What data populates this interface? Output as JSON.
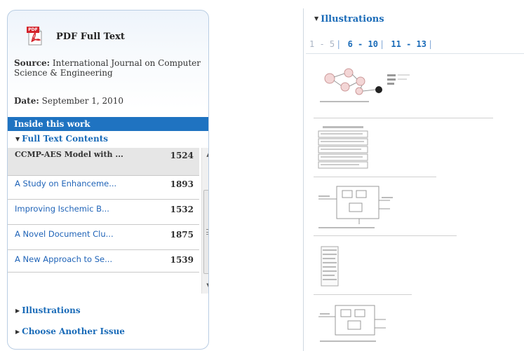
{
  "pdf": {
    "label": "PDF Full Text",
    "icon": "pdf-file-icon",
    "icon_tag": "PDF"
  },
  "source": {
    "label": "Source:",
    "value": "International Journal on Computer Science & Engineering"
  },
  "date": {
    "label": "Date:",
    "value": "September 1,  2010"
  },
  "inside": {
    "label": "Inside this work"
  },
  "full_text": {
    "label": "Full Text Contents"
  },
  "toc": [
    {
      "title": "CCMP-AES Model with ...",
      "number": "1524",
      "active": true
    },
    {
      "title": "A Study on Enhanceme...",
      "number": "1893"
    },
    {
      "title": "Improving Ischemic B...",
      "number": "1532"
    },
    {
      "title": "A Novel Document Clu...",
      "number": "1875"
    },
    {
      "title": "A New Approach to Se...",
      "number": "1539"
    }
  ],
  "left_sections": {
    "illustrations": "Illustrations",
    "choose_issue": "Choose Another Issue"
  },
  "illustrations": {
    "title": "Illustrations",
    "pages": {
      "current": "1 - 5",
      "p2": "6 - 10",
      "p3": "11 - 13"
    },
    "thumbnails": 5
  },
  "colors": {
    "accent": "#1f73c1",
    "link": "#1a6bb8",
    "pdf_red": "#d4232b"
  }
}
